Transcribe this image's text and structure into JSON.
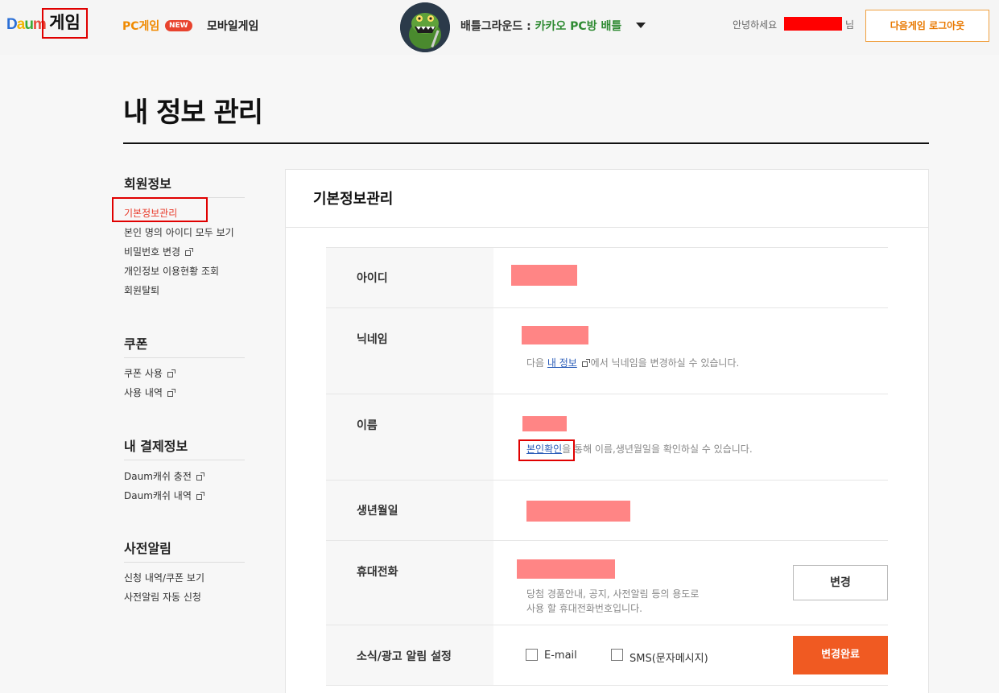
{
  "header": {
    "logo": {
      "d": "D",
      "a": "a",
      "u": "u",
      "m": "m"
    },
    "logo_game": "게임",
    "nav_pc": "PC게임",
    "nav_new_badge": "NEW",
    "nav_mobile": "모바일게임",
    "game_name_prefix": "배틀그라운드 : ",
    "game_name_suffix": "카카오 PC방 배틀",
    "greeting": "안녕하세요",
    "greeting_suffix": "님",
    "logout": "다음게임 로그아웃"
  },
  "page_title": "내 정보 관리",
  "sidebar": {
    "member": {
      "heading": "회원정보",
      "items": [
        "기본정보관리",
        "본인 명의 아이디 모두 보기",
        "비밀번호 변경",
        "개인정보 이용현황 조회",
        "회원탈퇴"
      ]
    },
    "coupon": {
      "heading": "쿠폰",
      "items": [
        "쿠폰 사용",
        "사용 내역"
      ]
    },
    "payment": {
      "heading": "내 결제정보",
      "items": [
        "Daum캐쉬 충전",
        "Daum캐쉬 내역"
      ]
    },
    "prereg": {
      "heading": "사전알림",
      "items": [
        "신청 내역/쿠폰 보기",
        "사전알림 자동 신청"
      ]
    }
  },
  "panel": {
    "title": "기본정보관리",
    "rows": {
      "id": {
        "label": "아이디"
      },
      "nickname": {
        "label": "닉네임",
        "hint_prefix": "다음 ",
        "hint_link": "내 정보",
        "hint_suffix": " 에서 닉네임을 변경하실 수 있습니다."
      },
      "name": {
        "label": "이름",
        "hint_link": "본인확인",
        "hint_suffix": "을 통해 이름,생년월일을 확인하실 수 있습니다."
      },
      "birth": {
        "label": "생년월일"
      },
      "phone": {
        "label": "휴대전화",
        "hint_line1": "당첨 경품안내, 공지, 사전알림 등의 용도로",
        "hint_line2": "사용 할 휴대전화번호입니다.",
        "change_button": "변경"
      },
      "notify": {
        "label": "소식/광고 알림 설정",
        "email_label": "E-mail",
        "email_checked": false,
        "sms_label": "SMS(문자메시지)",
        "sms_checked": false,
        "submit_button": "변경완료"
      }
    }
  },
  "colors": {
    "accent_orange": "#f05a22",
    "redaction": "#ff8585",
    "highlight_box": "#e00000",
    "link": "#2a5cb8"
  }
}
